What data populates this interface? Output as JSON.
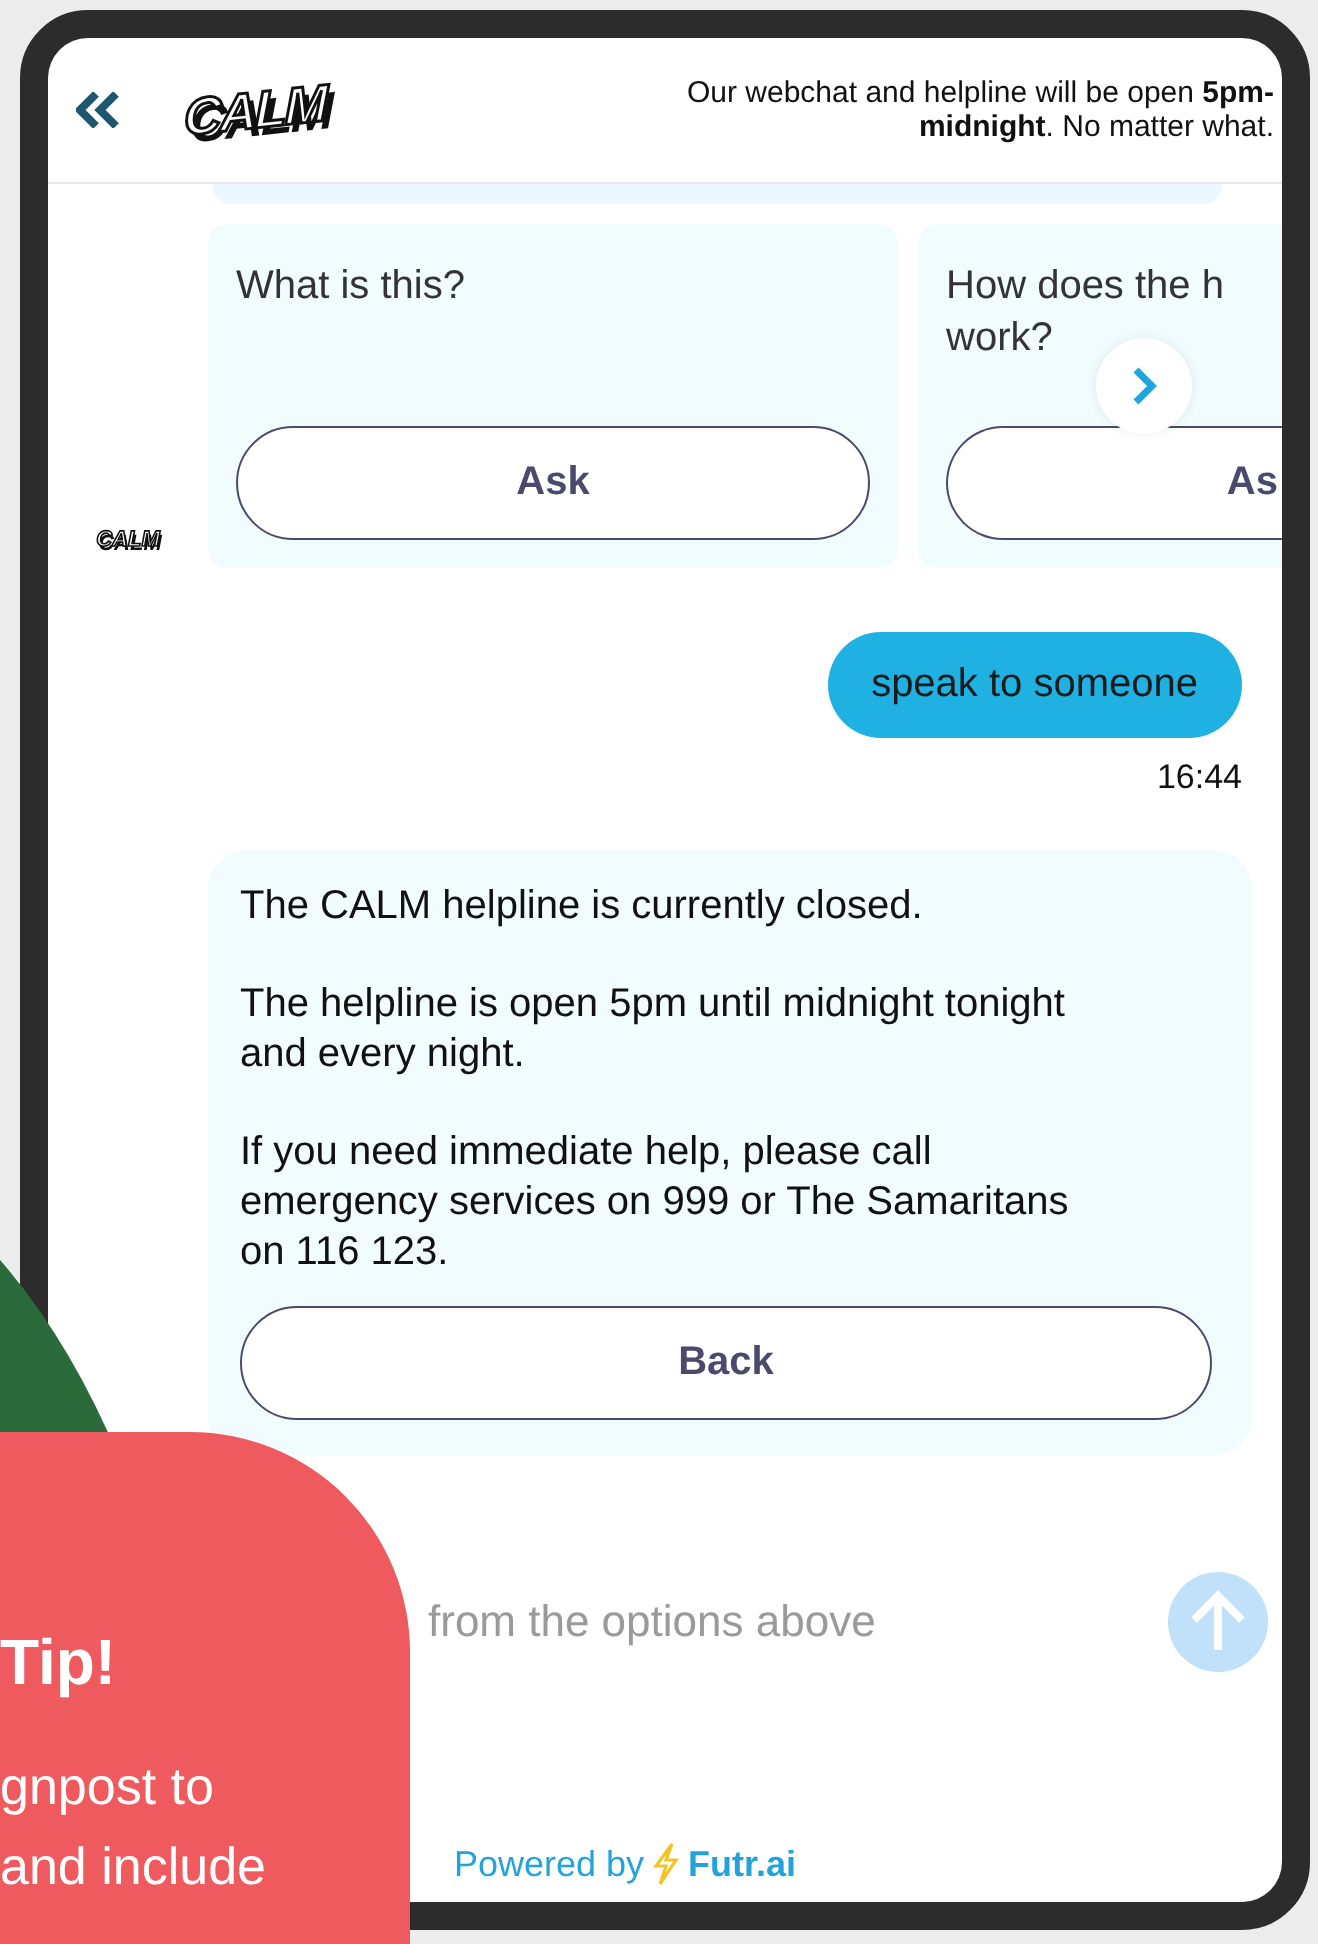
{
  "header": {
    "logo": "CALM",
    "notice": "Our webchat and helpline will be open **5pm-midnight**. No matter what."
  },
  "cards": [
    {
      "title": "What is this?",
      "button": "Ask"
    },
    {
      "title": "How does the h work?",
      "button": "As"
    }
  ],
  "avatar": "CALM",
  "user_message": {
    "text": "speak to someone",
    "time": "16:44"
  },
  "bot_message": {
    "paragraphs": [
      "The CALM helpline is currently closed.",
      "The helpline is open 5pm until midnight tonight and every night.",
      "If you need immediate help, please call emergency services on 999 or The Samaritans on 116 123."
    ],
    "button": "Back"
  },
  "input": {
    "placeholder": "from the options above"
  },
  "powered_by": {
    "prefix": "Powered by",
    "brand": "Futr.ai"
  },
  "tip": {
    "title": "Tip!",
    "lines": [
      "gnpost to",
      "and include"
    ]
  }
}
